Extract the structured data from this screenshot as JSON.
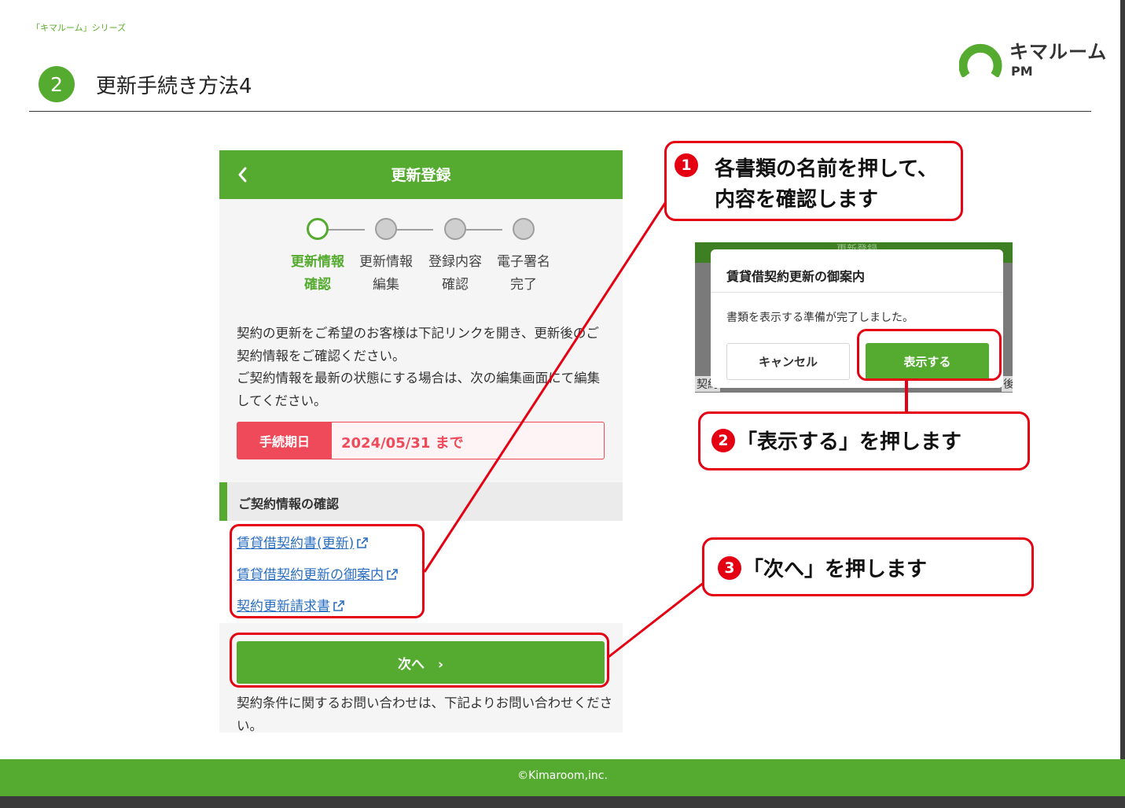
{
  "header": {
    "series": "「キマルーム」シリーズ",
    "step_number": "2",
    "title": "更新手続き方法4",
    "logo_name": "キマルーム",
    "logo_sub": "PM"
  },
  "phone": {
    "title": "更新登録",
    "steps": [
      {
        "line1": "更新情報",
        "line2": "確認",
        "active": true
      },
      {
        "line1": "更新情報",
        "line2": "編集",
        "active": false
      },
      {
        "line1": "登録内容",
        "line2": "確認",
        "active": false
      },
      {
        "line1": "電子署名",
        "line2": "完了",
        "active": false
      }
    ],
    "intro": [
      "契約の更新をご希望のお客様は下記リンクを開き、更新後のご契約情報をご確認ください。",
      "ご契約情報を最新の状態にする場合は、次の編集画面にて編集してください。"
    ],
    "deadline_label": "手続期日",
    "deadline_value": "2024/05/31 まで",
    "section_title": "ご契約情報の確認",
    "links": [
      "賃貸借契約書(更新)",
      "賃貸借契約更新の御案内",
      "契約更新請求書"
    ],
    "next_label": "次へ　›",
    "contact": "契約条件に関するお問い合わせは、下記よりお問い合わせください。"
  },
  "dialog": {
    "bg_title": "更新登録",
    "bg_left": "契約",
    "bg_right": "後",
    "title": "賃貸借契約更新の御案内",
    "message": "書類を表示する準備が完了しました。",
    "cancel_label": "キャンセル",
    "confirm_label": "表示する"
  },
  "callouts": [
    {
      "number": "1",
      "lines": [
        "各書類の名前を押して、",
        "内容を確認します"
      ]
    },
    {
      "number": "2",
      "text": "「表示する」を押します"
    },
    {
      "number": "3",
      "text": "「次へ」を押します"
    }
  ],
  "footer": {
    "copyright": "©Kimaroom,inc."
  },
  "colors": {
    "brand_green": "#55ab2f",
    "callout_red": "#e40012",
    "deadline_red": "#ee4a5a",
    "link_blue": "#2b6fc1"
  }
}
